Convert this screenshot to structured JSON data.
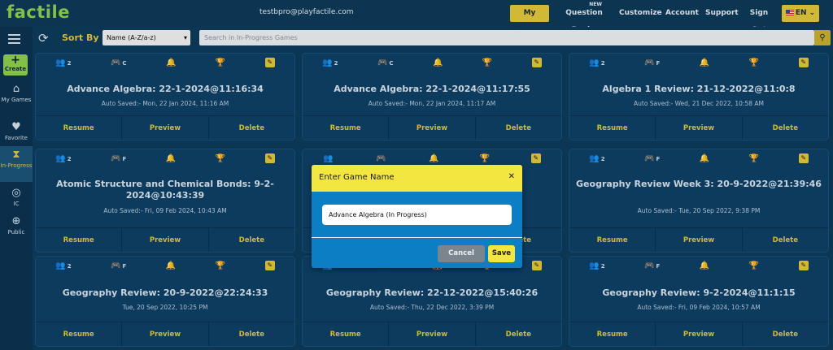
{
  "brand": {
    "logo": "factile"
  },
  "header": {
    "email": "testbpro@playfactile.com",
    "nav": [
      {
        "label": "My Games",
        "active": true
      },
      {
        "label": "Question Banks",
        "badge": "NEW"
      },
      {
        "label": "Customize"
      },
      {
        "label": "Account"
      },
      {
        "label": "Support"
      },
      {
        "label": "Sign Out"
      }
    ],
    "language": "EN"
  },
  "sidebar": {
    "create_label": "Create",
    "items": [
      {
        "label": "My Games",
        "icon": "home-icon"
      },
      {
        "label": "Favorite",
        "icon": "heart-icon"
      },
      {
        "label": "In-Progress",
        "icon": "hourglass-icon",
        "active": true
      },
      {
        "label": "IC",
        "icon": "ic-icon"
      },
      {
        "label": "Public",
        "icon": "globe-icon"
      }
    ]
  },
  "filter": {
    "sort_label": "Sort By",
    "sort_value": "Name (A-Z/a-z)",
    "search_placeholder": "Search in In-Progress Games"
  },
  "cards": [
    {
      "players": "2",
      "mode": "C",
      "title": "Advance Algebra: 22-1-2024@11:16:34",
      "saved": "Auto Saved:- Mon, 22 Jan 2024, 11:16 AM"
    },
    {
      "players": "2",
      "mode": "C",
      "title": "Advance Algebra: 22-1-2024@11:17:55",
      "saved": "Auto Saved:- Mon, 22 Jan 2024, 11:17 AM"
    },
    {
      "players": "2",
      "mode": "F",
      "title": "Algebra 1 Review: 21-12-2022@11:0:8",
      "saved": "Auto Saved:- Wed, 21 Dec 2022, 10:58 AM"
    },
    {
      "players": "2",
      "mode": "F",
      "title": "Atomic Structure and Chemical Bonds: 9-2-2024@10:43:39",
      "saved": "Auto Saved:- Fri, 09 Feb 2024, 10:43 AM"
    },
    {
      "players": "",
      "mode": "",
      "title": "",
      "saved": ""
    },
    {
      "players": "2",
      "mode": "F",
      "title": "Geography Review Week 3: 20-9-2022@21:39:46",
      "saved": "Auto Saved:- Tue, 20 Sep 2022, 9:38 PM"
    },
    {
      "players": "2",
      "mode": "F",
      "title": "Geography Review: 20-9-2022@22:24:33",
      "saved": "Tue, 20 Sep 2022, 10:25 PM"
    },
    {
      "players": "2",
      "mode": "F",
      "title": "Geography Review: 22-12-2022@15:40:26",
      "saved": "Auto Saved:- Thu, 22 Dec 2022, 3:39 PM"
    },
    {
      "players": "2",
      "mode": "F",
      "title": "Geography Review: 9-2-2024@11:1:15",
      "saved": "Auto Saved:- Fri, 09 Feb 2024, 10:57 AM"
    }
  ],
  "card_actions": {
    "resume": "Resume",
    "preview": "Preview",
    "delete": "Delete"
  },
  "modal": {
    "title": "Enter Game Name",
    "input_value": "Advance Algebra (In Progress)",
    "cancel_label": "Cancel",
    "save_label": "Save"
  },
  "colors": {
    "accent": "#e3c83a",
    "brand": "#8fd14f",
    "background": "#0d3b5c",
    "modal": "#0c7fc4"
  }
}
